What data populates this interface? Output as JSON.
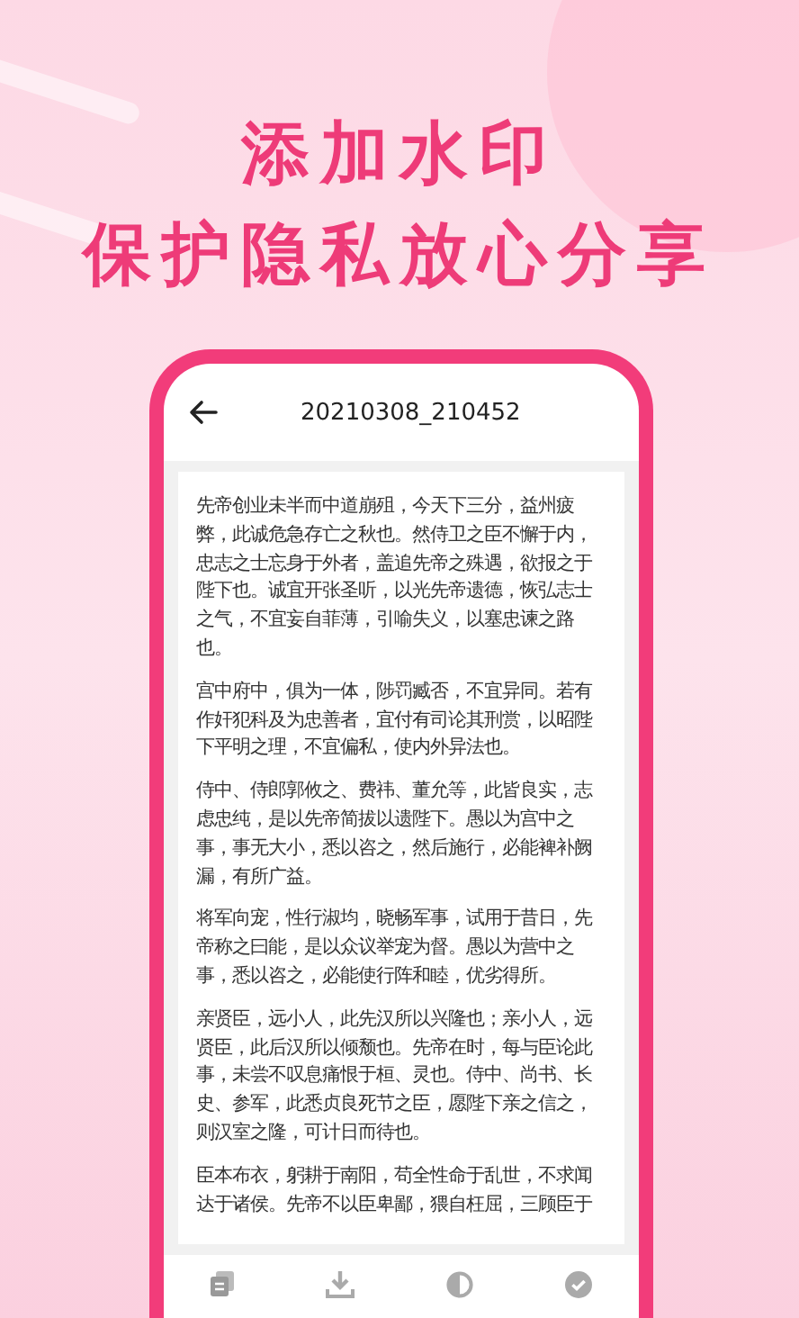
{
  "headline": [
    "添加水印",
    "保护隐私放心分享"
  ],
  "phone": {
    "title": "20210308_210452",
    "paragraphs": [
      "先帝创业未半而中道崩殂，今天下三分，益州疲弊，此诚危急存亡之秋也。然侍卫之臣不懈于内，忠志之士忘身于外者，盖追先帝之殊遇，欲报之于陛下也。诚宜开张圣听，以光先帝遗德，恢弘志士之气，不宜妄自菲薄，引喻失义，以塞忠谏之路也。",
      "宫中府中，俱为一体，陟罚臧否，不宜异同。若有作奸犯科及为忠善者，宜付有司论其刑赏，以昭陛下平明之理，不宜偏私，使内外异法也。",
      "侍中、侍郎郭攸之、费祎、董允等，此皆良实，志虑忠纯，是以先帝简拔以遗陛下。愚以为宫中之事，事无大小，悉以咨之，然后施行，必能裨补阙漏，有所广益。",
      "将军向宠，性行淑均，晓畅军事，试用于昔日，先帝称之曰能，是以众议举宠为督。愚以为营中之事，悉以咨之，必能使行阵和睦，优劣得所。",
      "亲贤臣，远小人，此先汉所以兴隆也；亲小人，远贤臣，此后汉所以倾颓也。先帝在时，每与臣论此事，未尝不叹息痛恨于桓、灵也。侍中、尚书、长史、参军，此悉贞良死节之臣，愿陛下亲之信之，则汉室之隆，可计日而待也。",
      "臣本布衣，躬耕于南阳，苟全性命于乱世，不求闻达于诸侯。先帝不以臣卑鄙，猥自枉屈，三顾臣于"
    ],
    "toolbar": [
      {
        "kind": "copy"
      },
      {
        "kind": "download"
      },
      {
        "kind": "contrast"
      },
      {
        "kind": "check"
      }
    ]
  }
}
